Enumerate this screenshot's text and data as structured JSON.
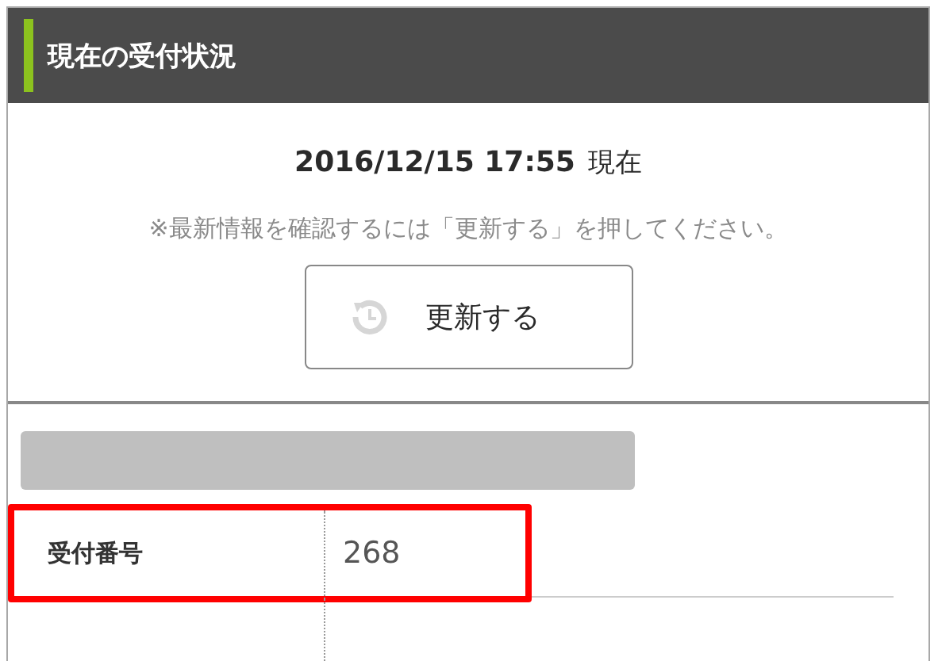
{
  "panel": {
    "title": "現在の受付状況"
  },
  "timestamp": {
    "datetime": "2016/12/15 17:55",
    "suffix": "現在"
  },
  "note": "※最新情報を確認するには「更新する」を押してください。",
  "refresh_button": {
    "label": "更新する"
  },
  "rows": [
    {
      "label": "受付番号",
      "value": "268",
      "highlighted": true
    }
  ]
}
